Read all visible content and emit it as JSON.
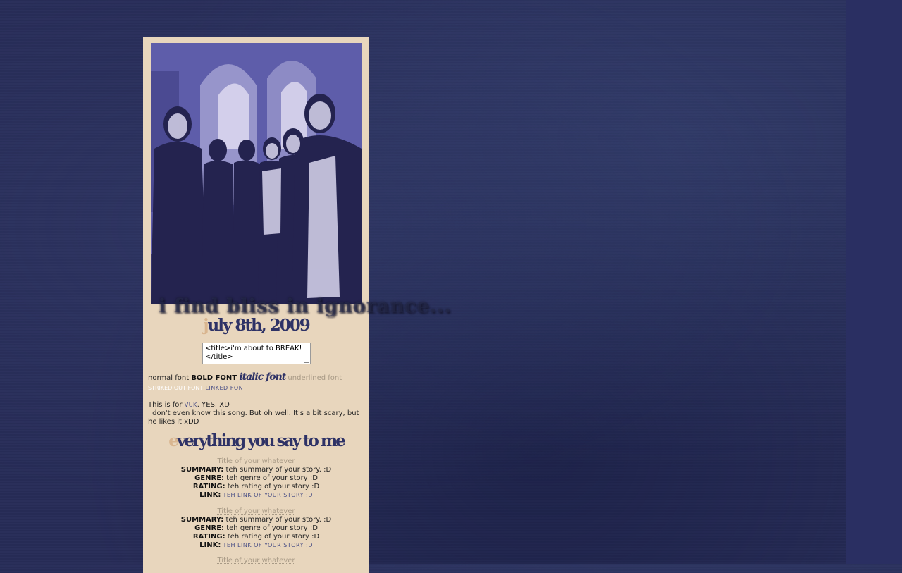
{
  "header": {
    "tagline": "i find bliss in ignorance...",
    "date_first": "j",
    "date_rest": "uly 8th, 2009"
  },
  "title_box": {
    "value": "<title>i'm about to BREAK!</title>"
  },
  "fonts": {
    "normal": "normal font",
    "bold": "BOLD FONT",
    "italic": "italic font",
    "underlined": "underlined font",
    "struck": "STRIKED OUT FONT",
    "linked": "LINKED FONT"
  },
  "post": {
    "line1_pre": "This is for",
    "line1_link": "VUK",
    "line1_post": ". YES. XD",
    "line2": "I don't even know this song. But oh well. It's a bit scary, but he likes it xDD"
  },
  "section": {
    "first": "e",
    "rest": "verything you say to me"
  },
  "stories": [
    {
      "title": "Title of your whatever",
      "summary_label": "SUMMARY:",
      "summary": "teh summary of your story. :D",
      "genre_label": "GENRE:",
      "genre": "teh genre of your story :D",
      "rating_label": "RATING:",
      "rating": "teh rating of your story :D",
      "link_label": "LINK:",
      "link": "TEH LINK OF YOUR STORY :D"
    },
    {
      "title": "Title of your whatever",
      "summary_label": "SUMMARY:",
      "summary": "teh summary of your story. :D",
      "genre_label": "GENRE:",
      "genre": "teh genre of your story :D",
      "rating_label": "RATING:",
      "rating": "teh rating of your story :D",
      "link_label": "LINK:",
      "link": "TEH LINK OF YOUR STORY :D"
    },
    {
      "title": "Title of your whatever"
    }
  ],
  "colors": {
    "background": "#272c57",
    "panel": "#e8d6bd",
    "heading": "#2e3266",
    "accent": "#d9b690",
    "link": "#4a4f86"
  }
}
